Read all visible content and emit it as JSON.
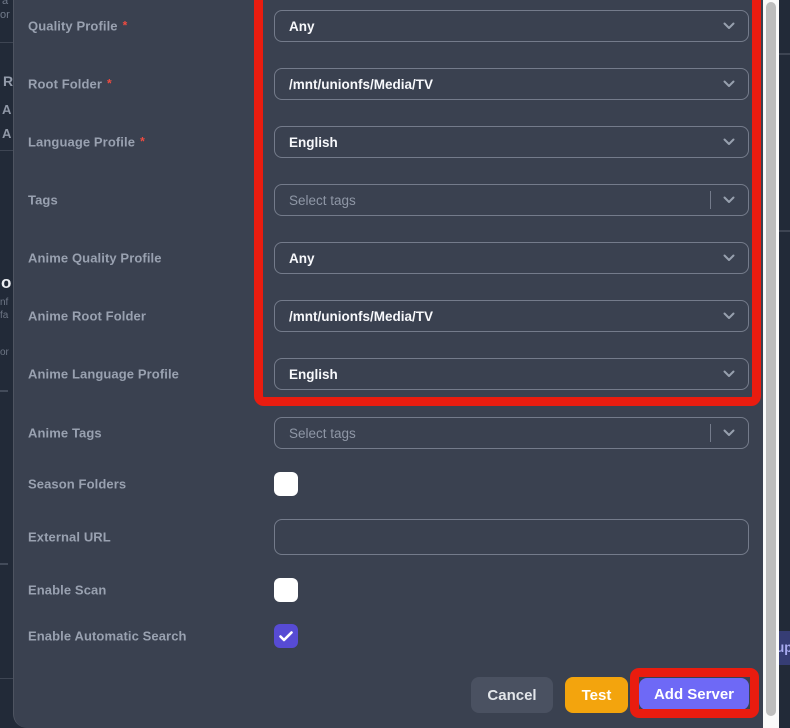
{
  "modal": {
    "required_marker": "*",
    "fields": [
      {
        "label": "Quality Profile",
        "required": true,
        "type": "select",
        "value": "Any"
      },
      {
        "label": "Root Folder",
        "required": true,
        "type": "select",
        "value": "/mnt/unionfs/Media/TV"
      },
      {
        "label": "Language Profile",
        "required": true,
        "type": "select",
        "value": "English"
      },
      {
        "label": "Tags",
        "required": false,
        "type": "multiselect",
        "placeholder": "Select tags"
      },
      {
        "label": "Anime Quality Profile",
        "required": false,
        "type": "select",
        "value": "Any"
      },
      {
        "label": "Anime Root Folder",
        "required": false,
        "type": "select",
        "value": "/mnt/unionfs/Media/TV"
      },
      {
        "label": "Anime Language Profile",
        "required": false,
        "type": "select",
        "value": "English"
      },
      {
        "label": "Anime Tags",
        "required": false,
        "type": "multiselect",
        "placeholder": "Select tags"
      },
      {
        "label": "Season Folders",
        "required": false,
        "type": "checkbox",
        "checked": false
      },
      {
        "label": "External URL",
        "required": false,
        "type": "text",
        "value": ""
      },
      {
        "label": "Enable Scan",
        "required": false,
        "type": "checkbox",
        "checked": false
      },
      {
        "label": "Enable Automatic Search",
        "required": false,
        "type": "checkbox",
        "checked": true
      }
    ],
    "footer": {
      "cancel_label": "Cancel",
      "test_label": "Test",
      "add_server_label": "Add Server"
    }
  },
  "background_page": {
    "left_fragments": [
      "a",
      "or",
      "R",
      "A",
      "A",
      "o",
      "nf",
      "fa",
      "or"
    ],
    "right_fragment_label": "up"
  },
  "annotations": {
    "highlighted_regions": [
      "profile-and-folder-dropdowns",
      "add-server-button"
    ]
  },
  "colors": {
    "red": "#e91c0f",
    "accent": "#6e69f6",
    "orange": "#f3a40d",
    "cancel": "#4a5161",
    "checkbox": "#574bd4",
    "modal_bg": "#3a4150",
    "page_bg": "#222a38"
  }
}
